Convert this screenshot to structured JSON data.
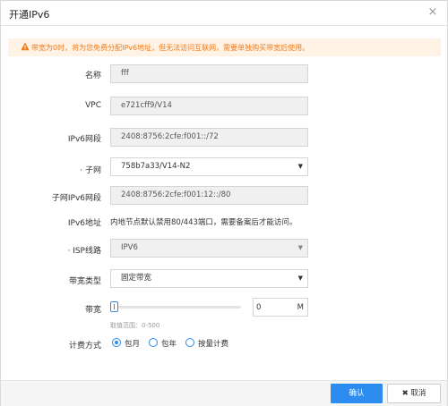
{
  "dialog": {
    "title": "开通IPv6",
    "close_icon": "close-icon"
  },
  "warning": {
    "icon": "warning-icon",
    "color": "#f07a19",
    "text": "带宽为0时，将为您免费分配IPv6地址，但无法访问互联网，需要单独购买带宽后使用。"
  },
  "form": {
    "name": {
      "label": "名称",
      "value": "fff"
    },
    "vpc": {
      "label": "VPC",
      "value": "e721cff9/V14"
    },
    "ipv6_segment": {
      "label": "IPv6网段",
      "value": "2408:8756:2cfe:f001::/72"
    },
    "subnet": {
      "label": "· 子网",
      "value": "758b7a33/V14-N2"
    },
    "subnet_ipv6_segment": {
      "label": "子网IPv6网段",
      "value": "2408:8756:2cfe:f001:12::/80"
    },
    "ipv6_address": {
      "label": "IPv6地址",
      "value": "内地节点默认禁用80/443端口，需要备案后才能访问。"
    },
    "isp_line": {
      "label": "· ISP线路",
      "value": "IPV6"
    },
    "bandwidth_type": {
      "label": "带宽类型",
      "value": "固定带宽"
    },
    "bandwidth": {
      "label": "带宽",
      "value": "0",
      "unit": "M",
      "hint": "取值范围：0-500",
      "fraction": 0
    },
    "billing": {
      "label": "计费方式",
      "options": [
        "包月",
        "包年",
        "按量计费"
      ],
      "selected": "包月"
    }
  },
  "footer": {
    "ok_label": "确认",
    "cancel_label": "✖ 取消"
  },
  "colors": {
    "accent": "#2d8cf0",
    "warning_bg": "#fff3e6"
  }
}
